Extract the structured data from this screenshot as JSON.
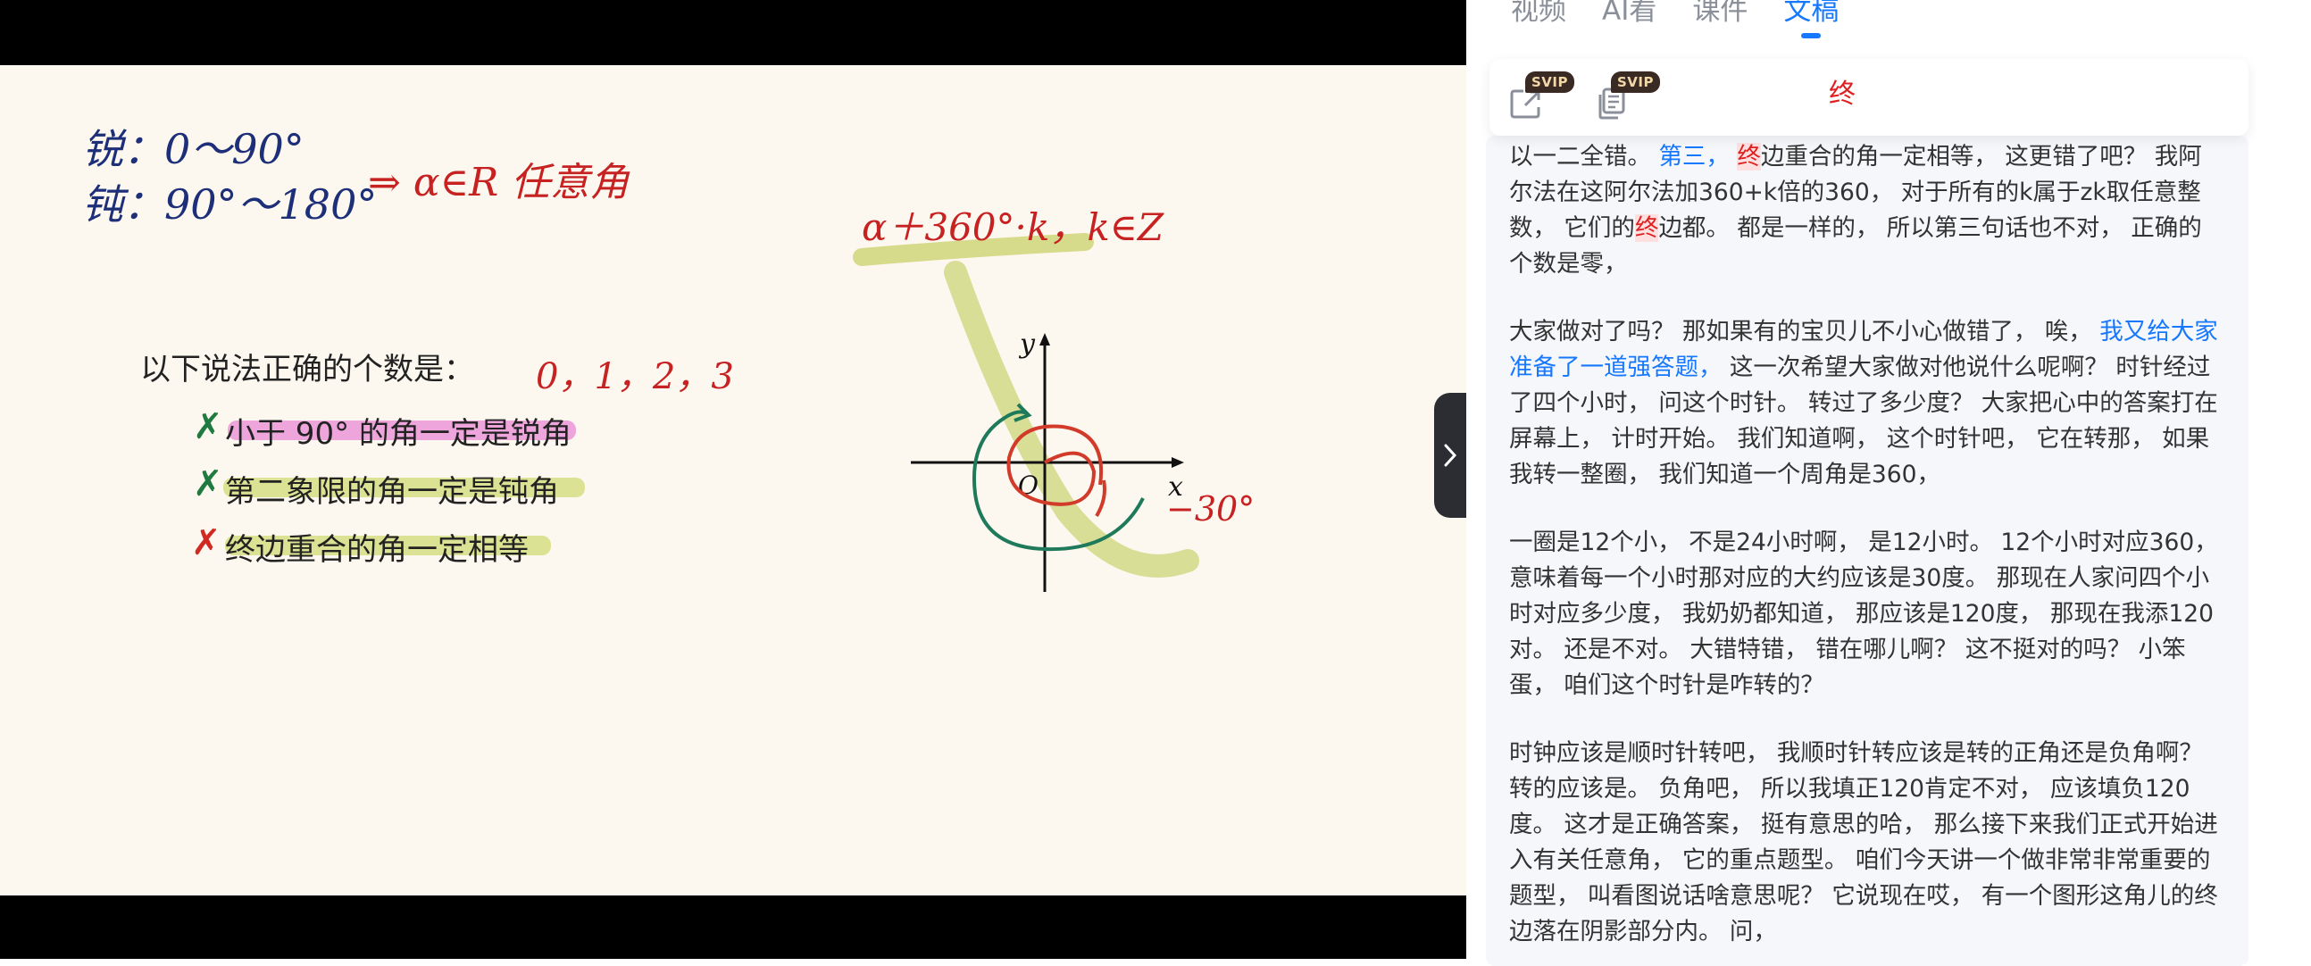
{
  "slide": {
    "acute": "锐：0～90°",
    "obtuse": "钝：90°～180°",
    "arrow_note": "⇒ α∈R 任意角",
    "formula": "α＋360°·k，k∈Z",
    "question": "以下说法正确的个数是：",
    "options": "0，1，2，3",
    "statements": [
      "小于 90° 的角一定是锐角",
      "第二象限的角一定是钝角",
      "终边重合的角一定相等"
    ],
    "mark": "✗",
    "axis_y": "y",
    "axis_x": "x",
    "origin": "O",
    "angle_label": "−30°"
  },
  "panel": {
    "tabs": [
      "视频",
      "AI看",
      "课件",
      "文稿"
    ],
    "active_tab": "文稿",
    "toolbar": {
      "badge_1": "SVIP",
      "badge_2": "SVIP",
      "search_term": "终"
    },
    "transcript": [
      {
        "segments": [
          {
            "t": "以一二全错。 ",
            "s": ""
          },
          {
            "t": "第三，",
            "s": "blue"
          },
          {
            "t": " ",
            "s": ""
          },
          {
            "t": "终",
            "s": "hit"
          },
          {
            "t": "边重合的角一定相等， 这更错了吧？ 我阿尔法在这阿尔法加360+k倍的360， 对于所有的k属于zk取任意整数， 它们的",
            "s": ""
          },
          {
            "t": "终",
            "s": "hit"
          },
          {
            "t": "边都。 都是一样的， 所以第三句话也不对， 正确的个数是零，",
            "s": ""
          }
        ]
      },
      {
        "segments": [
          {
            "t": "大家做对了吗？ 那如果有的宝贝儿不小心做错了， 唉， ",
            "s": ""
          },
          {
            "t": "我又给大家准备了一道强答题，",
            "s": "blue"
          },
          {
            "t": " 这一次希望大家做对他说什么呢啊？ 时针经过了四个小时， 问这个时针。 转过了多少度？ 大家把心中的答案打在屏幕上， 计时开始。 我们知道啊， 这个时针吧， 它在转那， 如果我转一整圈， 我们知道一个周角是360，",
            "s": ""
          }
        ]
      },
      {
        "segments": [
          {
            "t": "一圈是12个小， 不是24小时啊， 是12小时。 12个小时对应360， 意味着每一个小时那对应的大约应该是30度。 那现在人家问四个小时对应多少度， 我奶奶都知道， 那应该是120度， 那现在我添120对。 还是不对。 大错特错， 错在哪儿啊？ 这不挺对的吗？ 小笨蛋， 咱们这个时针是咋转的？",
            "s": ""
          }
        ]
      },
      {
        "segments": [
          {
            "t": "时钟应该是顺时针转吧， 我顺时针转应该是转的正角还是负角啊？ 转的应该是。 负角吧， 所以我填正120肯定不对， 应该填负120度。 这才是正确答案， 挺有意思的哈， 那么接下来我们正式开始进入有关任意角， 它的重点题型。 咱们今天讲一个做非常非常重要的题型， 叫看图说话啥意思呢？ 它说现在哎， 有一个图形这角儿的终边落在阴影部分内。 问，",
            "s": ""
          }
        ]
      }
    ]
  }
}
